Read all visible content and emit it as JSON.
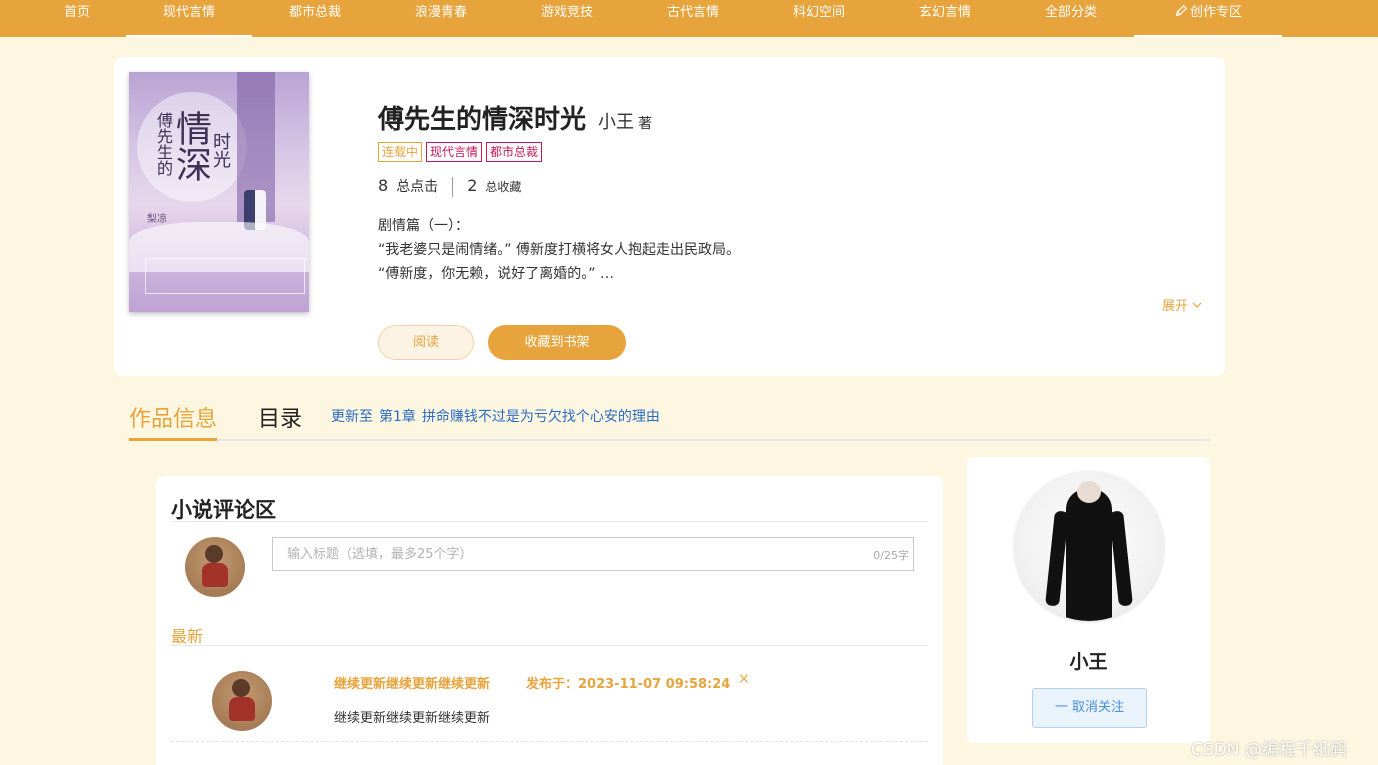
{
  "nav": {
    "items": [
      {
        "label": "首页"
      },
      {
        "label": "现代言情"
      },
      {
        "label": "都市总裁"
      },
      {
        "label": "浪漫青春"
      },
      {
        "label": "游戏竞技"
      },
      {
        "label": "古代言情"
      },
      {
        "label": "科幻空间"
      },
      {
        "label": "玄幻言情"
      },
      {
        "label": "全部分类"
      },
      {
        "label": "创作专区",
        "icon": "pen-icon"
      }
    ],
    "active": "现代言情"
  },
  "book": {
    "title": "傅先生的情深时光",
    "author": "小王",
    "author_suffix": "著",
    "tags": [
      "连载中",
      "现代言情",
      "都市总裁"
    ],
    "clicks": "8",
    "clicks_label": "总点击",
    "favorites": "2",
    "favorites_label": "总收藏",
    "desc_lines": [
      "剧情篇（一）：",
      "“我老婆只是闹情绪。” 傅新度打横将女人抱起走出民政局。",
      "“傅新度，你无赖，说好了离婚的。” …"
    ],
    "expand_label": "展开",
    "read_button": "阅读",
    "shelf_button": "收藏到书架",
    "cover": {
      "title_main": "情深",
      "title_left": "傅先生的",
      "title_right": "时光",
      "pen_name": "梨凉"
    }
  },
  "tabs": {
    "info": "作品信息",
    "toc": "目录",
    "update_prefix": "更新至",
    "update_chapter": "第1章",
    "update_title": "拼命赚钱不过是为亏欠找个心安的理由"
  },
  "comments": {
    "title": "小说评论区",
    "input_placeholder": "输入标题（选填，最多25个字）",
    "input_count": "0/25字",
    "latest_label": "最新",
    "items": [
      {
        "title": "继续更新继续更新继续更新",
        "time": "发布于：2023-11-07 09:58:24",
        "body": "继续更新继续更新继续更新",
        "delete_glyph": "×"
      }
    ]
  },
  "author_card": {
    "name": "小王",
    "unfollow_label": "一 取消关注"
  },
  "watermark": "CSDN @编程千纸鹤",
  "colors": {
    "accent": "#e8a43c",
    "page_bg": "#fdf6e0",
    "link": "#2a6cc4",
    "tag_red": "#c2185b"
  }
}
